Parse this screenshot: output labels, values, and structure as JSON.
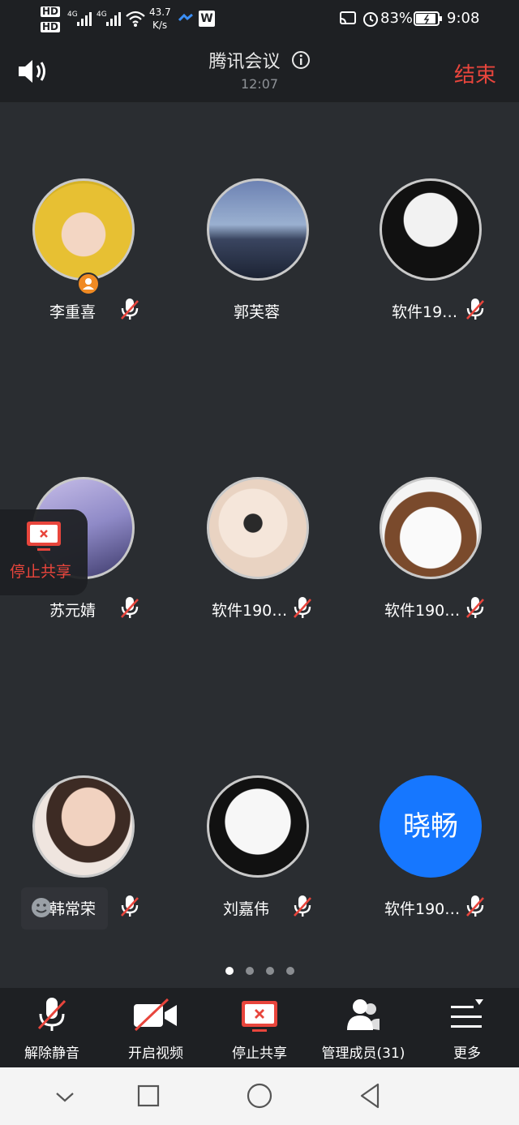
{
  "status_bar": {
    "hd1": "HD",
    "hd2": "HD",
    "net1": "4G",
    "net2": "4G",
    "speed_value": "43.7",
    "speed_unit": "K/s",
    "battery": "83%",
    "time": "9:08"
  },
  "header": {
    "title": "腾讯会议",
    "timer": "12:07",
    "end_label": "结束"
  },
  "participants": [
    {
      "name": "李重喜",
      "muted": true,
      "host": true
    },
    {
      "name": "郭芙蓉",
      "muted": false
    },
    {
      "name": "软件19…",
      "muted": true
    },
    {
      "name": "苏元婧",
      "muted": true
    },
    {
      "name": "软件190…",
      "muted": true
    },
    {
      "name": "软件190…",
      "muted": true
    },
    {
      "name": "韩常荣",
      "muted": true
    },
    {
      "name": "刘嘉伟",
      "muted": true
    },
    {
      "name": "软件190…",
      "muted": true,
      "avatar_text": "晓畅"
    }
  ],
  "floating": {
    "stop_share_label": "停止共享"
  },
  "pagination": {
    "total": 4,
    "current": 1
  },
  "toolbar": {
    "unmute_label": "解除静音",
    "video_label": "开启视频",
    "stop_share_label": "停止共享",
    "members_label": "管理成员(31)",
    "more_label": "更多"
  },
  "colors": {
    "accent_red": "#e8453c",
    "avatar_blue": "#1677ff",
    "background": "#2a2d31",
    "bar": "#1e2023"
  },
  "icons": [
    "speaker-icon",
    "info-icon",
    "mic-muted-icon",
    "host-badge-icon",
    "screen-share-icon",
    "video-off-icon",
    "members-icon",
    "more-icon",
    "nav-back-icon",
    "nav-home-icon",
    "nav-recents-icon",
    "nav-down-icon"
  ]
}
